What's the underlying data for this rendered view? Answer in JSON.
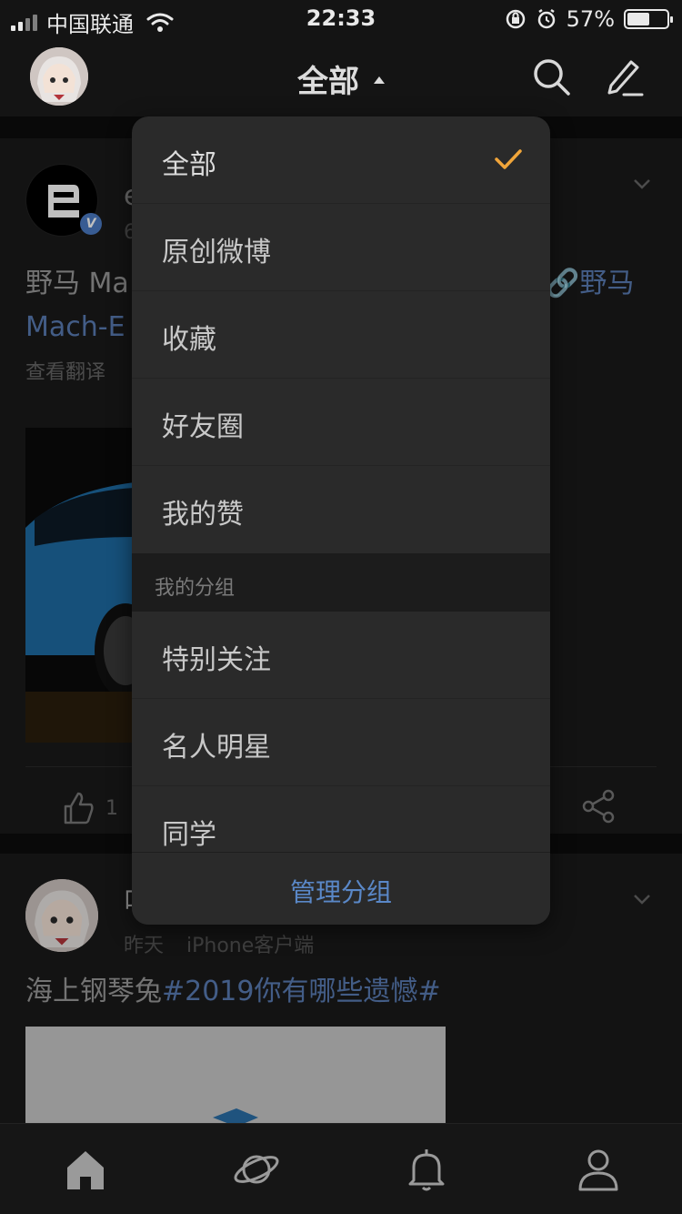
{
  "status_bar": {
    "carrier": "中国联通",
    "time": "22:33",
    "battery_text": "57%",
    "battery_level": 0.57
  },
  "nav": {
    "title": "全部",
    "icons": [
      "avatar",
      "search-icon",
      "compose-icon"
    ]
  },
  "feed": {
    "post1": {
      "author_partial": "e",
      "meta_partial": "6",
      "text_visible": "野马 Ma",
      "text_link_right": "野马",
      "text_link_line2": "Mach-E",
      "translate_label": "查看翻译",
      "like_count_partial": "1"
    },
    "post2": {
      "author_partial": "叫",
      "meta": {
        "time": "昨天",
        "source": "iPhone客户端"
      },
      "text_plain": "海上钢琴兔",
      "text_hashtag": "#2019你有哪些遗憾#"
    }
  },
  "dropdown": {
    "items": [
      {
        "label": "全部",
        "selected": true
      },
      {
        "label": "原创微博",
        "selected": false
      },
      {
        "label": "收藏",
        "selected": false
      },
      {
        "label": "好友圈",
        "selected": false
      },
      {
        "label": "我的赞",
        "selected": false
      }
    ],
    "section_title": "我的分组",
    "group_items": [
      {
        "label": "特别关注"
      },
      {
        "label": "名人明星"
      },
      {
        "label": "同学"
      }
    ],
    "footer_label": "管理分组",
    "accent_color": "#f0a53a",
    "link_color": "#5a88c8"
  },
  "tab_bar": {
    "tabs": [
      "home-icon",
      "discover-icon",
      "notifications-icon",
      "profile-icon"
    ]
  }
}
